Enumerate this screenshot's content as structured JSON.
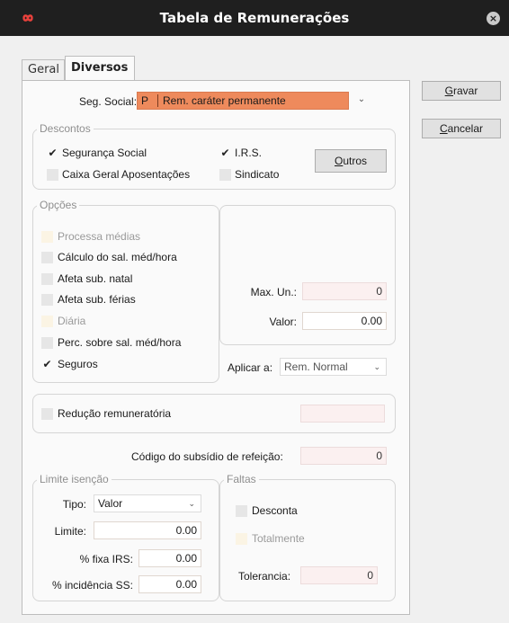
{
  "window": {
    "title": "Tabela de Remunerações",
    "close_icon": "×"
  },
  "tabs": [
    {
      "label": "Geral"
    },
    {
      "label": "Diversos"
    }
  ],
  "buttons": {
    "gravar_first": "G",
    "gravar_rest": "ravar",
    "cancelar_first": "C",
    "cancelar_rest": "ancelar"
  },
  "seg_social": {
    "label": "Seg. Social:",
    "code": "P",
    "value": "Rem. caráter permanente"
  },
  "descontos": {
    "title": "Descontos",
    "seguranca_social": "Segurança Social",
    "caixa_geral": "Caixa Geral Aposentações",
    "irs": "I.R.S.",
    "sindicato": "Sindicato",
    "outros_first": "O",
    "outros_rest": "utros"
  },
  "opcoes": {
    "title": "Opções",
    "processa_medias": "Processa médias",
    "calculo_sal": "Cálculo do sal. méd/hora",
    "afeta_natal": "Afeta sub. natal",
    "afeta_ferias": "Afeta sub. férias",
    "diaria": "Diária",
    "perc_sobre": "Perc. sobre sal. méd/hora",
    "seguros": "Seguros",
    "max_un_label": "Max. Un.:",
    "max_un_value": "0",
    "valor_label": "Valor:",
    "valor_value": "0.00",
    "aplicar_label": "Aplicar a:",
    "aplicar_value": "Rem. Normal"
  },
  "reducao": {
    "label": "Redução remuneratória",
    "value": ""
  },
  "subsidio": {
    "label": "Código do subsídio de refeição:",
    "value": "0"
  },
  "limite_isencao": {
    "title": "Limite isenção",
    "tipo_label": "Tipo:",
    "tipo_value": "Valor",
    "limite_label": "Limite:",
    "limite_value": "0.00",
    "fixa_irs_label": "% fixa IRS:",
    "fixa_irs_value": "0.00",
    "incidencia_label": "% incidência SS:",
    "incidencia_value": "0.00"
  },
  "faltas": {
    "title": "Faltas",
    "desconta": "Desconta",
    "totalmente": "Totalmente",
    "tolerancia_label": "Tolerancia:",
    "tolerancia_value": "0"
  },
  "colors": {
    "titlebar": "#1f1f1f",
    "accent_field": "#ee8a5c",
    "logo": "#e8413c"
  },
  "checkmark": "✔",
  "dropdown_arrow": "⌄"
}
